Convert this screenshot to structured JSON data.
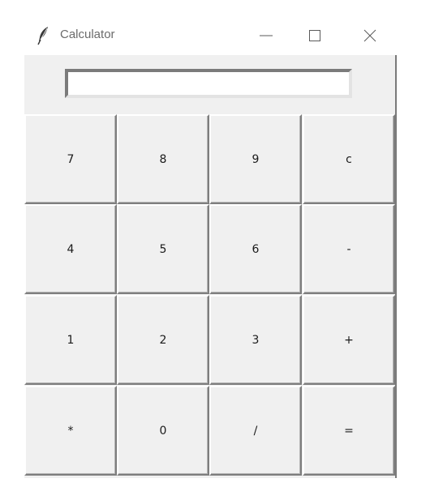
{
  "window": {
    "title": "Calculator"
  },
  "display": {
    "value": ""
  },
  "keypad": {
    "rows": [
      [
        "7",
        "8",
        "9",
        "c"
      ],
      [
        "4",
        "5",
        "6",
        "-"
      ],
      [
        "1",
        "2",
        "3",
        "+"
      ],
      [
        "*",
        "0",
        "/",
        "="
      ]
    ]
  },
  "icons": {
    "app": "feather-icon",
    "minimize": "minimize-icon",
    "maximize": "maximize-icon",
    "close": "close-icon"
  }
}
